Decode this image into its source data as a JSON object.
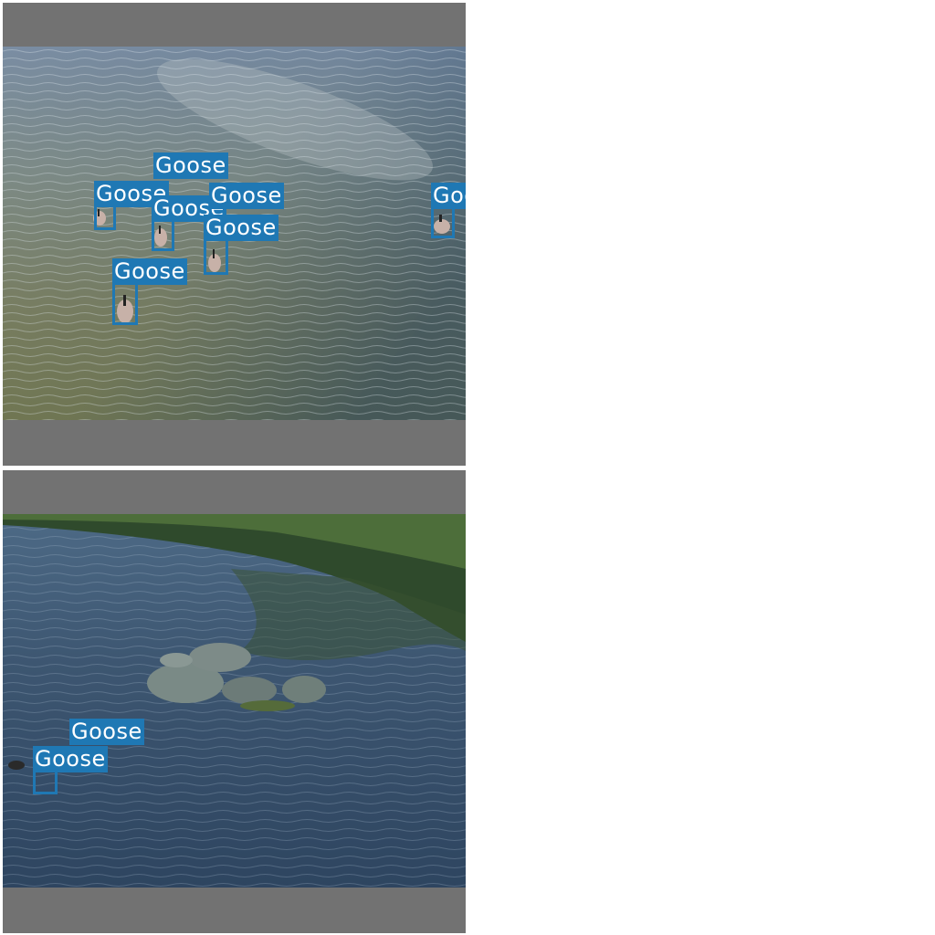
{
  "detections": {
    "top": [
      {
        "label": "Goose"
      },
      {
        "label": "Goose"
      },
      {
        "label": "Goose"
      },
      {
        "label": "Goose"
      },
      {
        "label": "Goose"
      },
      {
        "label": "Goose"
      },
      {
        "label": "Goose"
      }
    ],
    "bottom": [
      {
        "label": "Goose"
      },
      {
        "label": "Goose"
      }
    ]
  },
  "colors": {
    "box": "#1f78b4",
    "letterbox": "#727272",
    "background": "#ffffff"
  }
}
